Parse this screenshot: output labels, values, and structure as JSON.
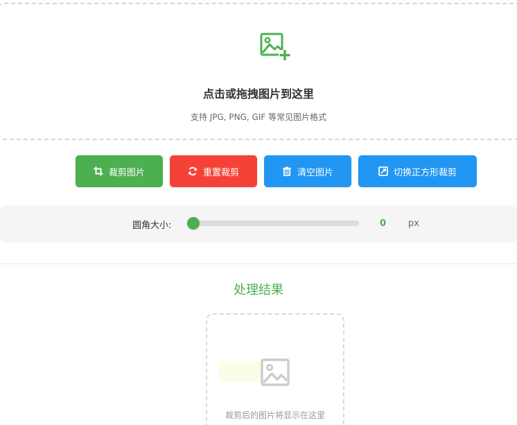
{
  "upload": {
    "icon": "add-image-icon",
    "title": "点击或拖拽图片到这里",
    "hint": "支持 JPG, PNG, GIF 等常见图片格式",
    "accent_color": "#4caf50"
  },
  "toolbar": {
    "crop": {
      "label": "裁剪图片",
      "icon": "crop-icon",
      "color": "#4caf50"
    },
    "reset": {
      "label": "重置裁剪",
      "icon": "refresh-icon",
      "color": "#f44336"
    },
    "clear": {
      "label": "清空图片",
      "icon": "trash-icon",
      "color": "#2196f3"
    },
    "square": {
      "label": "切换正方形裁剪",
      "icon": "square-crop-icon",
      "color": "#2196f3"
    }
  },
  "radius": {
    "label": "圆角大小:",
    "value": "0",
    "unit": "px",
    "level": 0
  },
  "result": {
    "title": "处理结果",
    "icon": "image-placeholder-icon",
    "placeholder": "裁剪后的图片将显示在这里"
  }
}
